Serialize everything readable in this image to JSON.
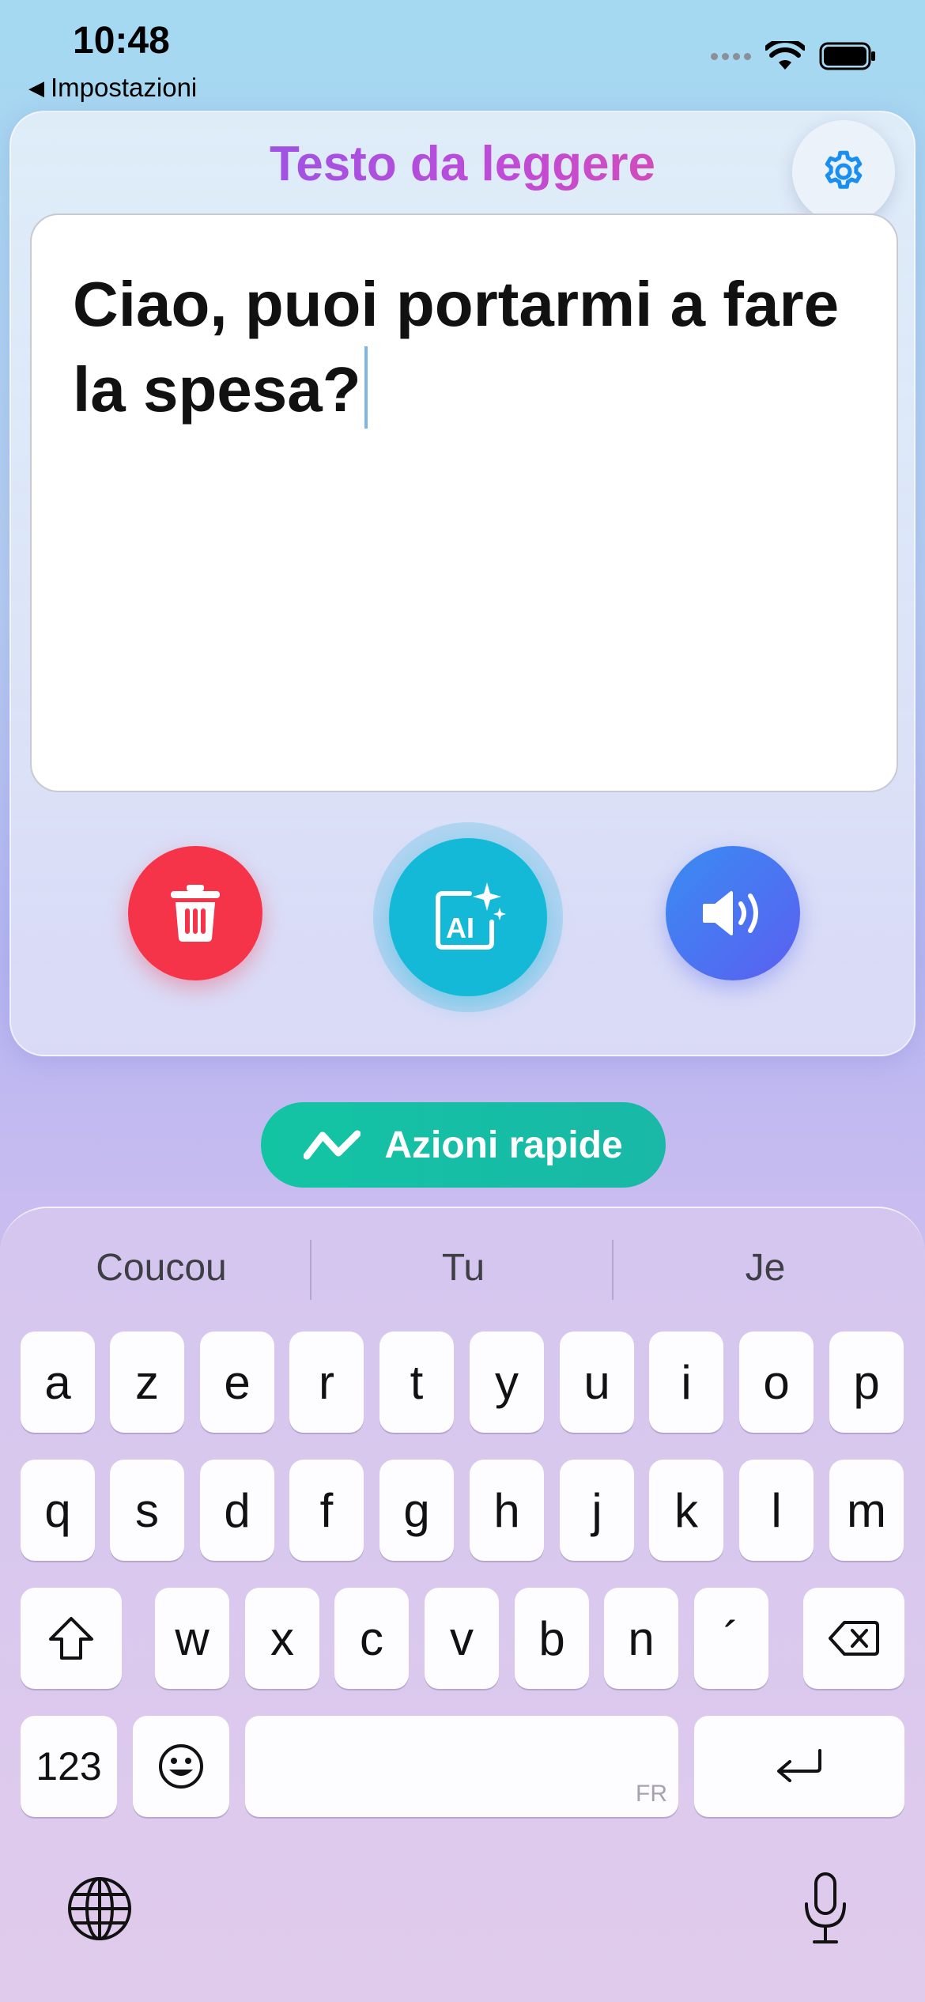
{
  "status_bar": {
    "time": "10:48",
    "back_label": "Impostazioni",
    "back_arrow": "◀"
  },
  "card": {
    "title": "Testo da leggere",
    "text": "Ciao, puoi portarmi a fare la spesa?",
    "settings_icon": "gear-icon",
    "buttons": {
      "delete_icon": "trash-icon",
      "ai_icon": "ai-sparkle-icon",
      "speak_icon": "speaker-icon"
    }
  },
  "quick_actions": {
    "label": "Azioni rapide"
  },
  "keyboard": {
    "suggestions": [
      "Coucou",
      "Tu",
      "Je"
    ],
    "row1": [
      "a",
      "z",
      "e",
      "r",
      "t",
      "y",
      "u",
      "i",
      "o",
      "p"
    ],
    "row2": [
      "q",
      "s",
      "d",
      "f",
      "g",
      "h",
      "j",
      "k",
      "l",
      "m"
    ],
    "row3": [
      "w",
      "x",
      "c",
      "v",
      "b",
      "n",
      "´"
    ],
    "numbers_label": "123",
    "space_language": "FR"
  },
  "colors": {
    "accent_delete": "#f53349",
    "accent_ai": "#15b9d8",
    "accent_speak": "#4a78f2",
    "quick_actions": "#13c4a3",
    "title_gradient": [
      "#7b5cf0",
      "#ef4d8a"
    ]
  }
}
